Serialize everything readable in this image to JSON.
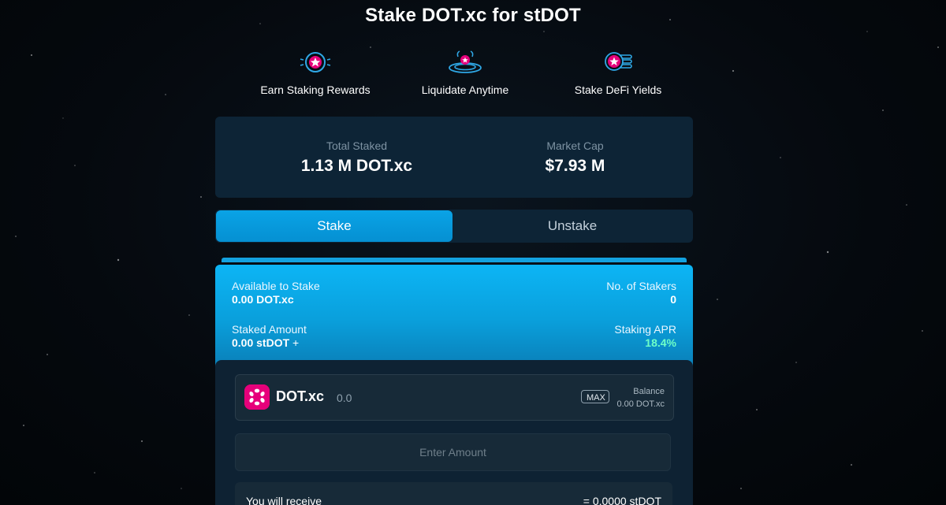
{
  "page_title": "Stake DOT.xc for stDOT",
  "features": [
    {
      "label": "Earn Staking Rewards",
      "icon": "staking-coin-icon"
    },
    {
      "label": "Liquidate Anytime",
      "icon": "liquid-drop-icon"
    },
    {
      "label": "Stake DeFi Yields",
      "icon": "coin-stack-icon"
    }
  ],
  "stats": {
    "total_staked_label": "Total Staked",
    "total_staked_value": "1.13 M DOT.xc",
    "market_cap_label": "Market Cap",
    "market_cap_value": "$7.93 M"
  },
  "tabs": {
    "stake_label": "Stake",
    "unstake_label": "Unstake",
    "active": "Stake"
  },
  "info": {
    "available_label": "Available to Stake",
    "available_value": "0.00 DOT.xc",
    "stakers_label": "No. of Stakers",
    "stakers_value": "0",
    "staked_label": "Staked Amount",
    "staked_value": "0.00 stDOT",
    "apr_label": "Staking APR",
    "apr_value": "18.4%"
  },
  "token": {
    "name": "DOT.xc",
    "amount": "0.0",
    "max_label": "MAX",
    "balance_label": "Balance",
    "balance_value": "0.00 DOT.xc"
  },
  "amount_input": {
    "placeholder": "Enter Amount",
    "value": ""
  },
  "receive": {
    "label": "You will receive",
    "value": "= 0.0000 stDOT"
  },
  "colors": {
    "accent": "#0aa3e6",
    "panel": "#0d2436",
    "apr_green": "#6effc8",
    "polkadot_pink": "#e6007a"
  }
}
